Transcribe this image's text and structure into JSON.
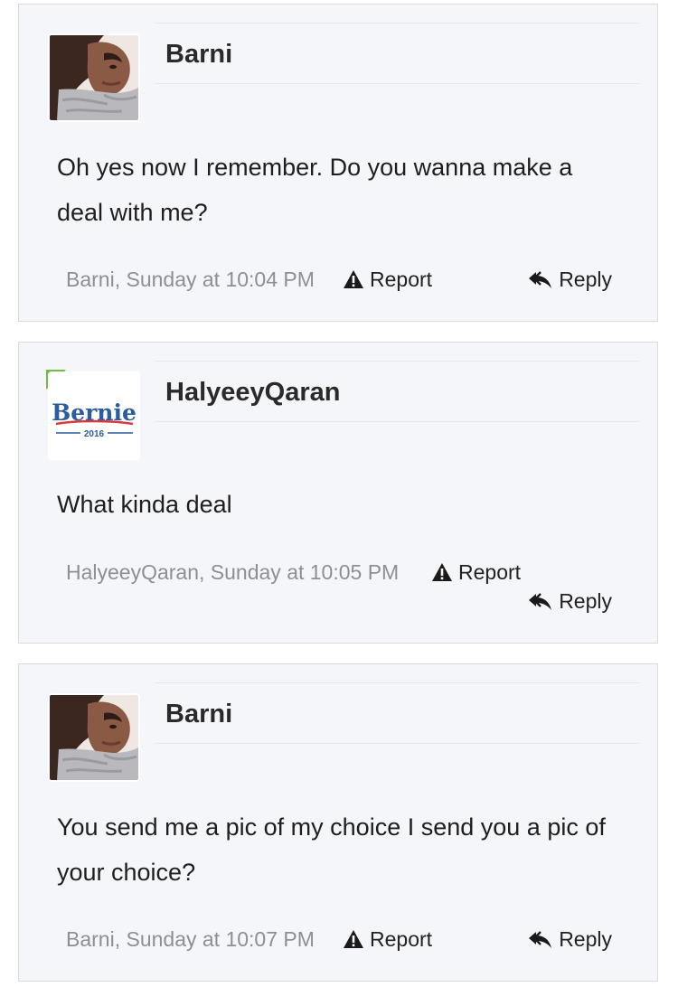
{
  "posts": [
    {
      "username": "Barni",
      "message": "Oh yes now I remember. Do you wanna make a deal with me?",
      "meta": "Barni, Sunday at 10:04 PM",
      "report_label": "Report",
      "reply_label": "Reply"
    },
    {
      "username": "HalyeeyQaran",
      "message": "What kinda deal",
      "meta": "HalyeeyQaran, Sunday at 10:05 PM",
      "report_label": "Report",
      "reply_label": "Reply",
      "avatar_text": "Bernie",
      "avatar_year": "2016"
    },
    {
      "username": "Barni",
      "message": "You send me a pic of my choice I send you a pic of your choice?",
      "meta": "Barni, Sunday at 10:07 PM",
      "report_label": "Report",
      "reply_label": "Reply"
    }
  ],
  "colors": {
    "post_bg": "#f5f6fa",
    "border": "#d8dade",
    "meta_text": "#8d8f94",
    "new_indicator": "#74b944",
    "bernie_blue": "#2a5c9e",
    "bernie_red": "#d43a3a"
  },
  "icons": {
    "report": "warning-triangle-icon",
    "reply": "reply-arrow-icon"
  }
}
